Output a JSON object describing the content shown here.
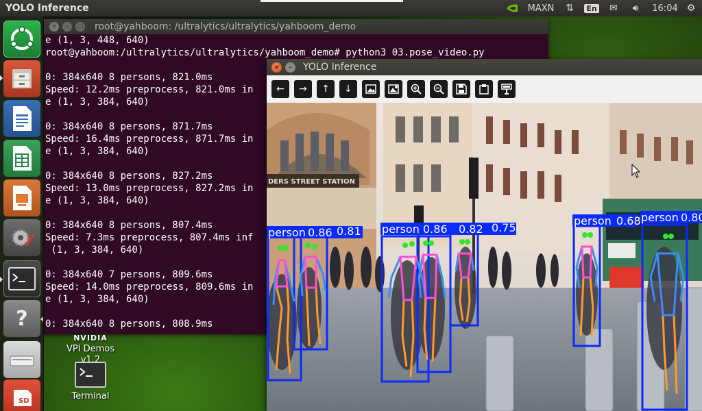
{
  "top_panel": {
    "app_title": "YOLO Inference",
    "power_mode": "MAXN",
    "keyboard_layout": "En",
    "clock": "16:04",
    "icons": [
      "nvidia-icon",
      "network-icon",
      "mail-icon",
      "sound-icon",
      "gear-icon"
    ]
  },
  "launcher": {
    "items": [
      "ubuntu-dash-icon",
      "files-icon",
      "writer-icon",
      "calc-icon",
      "impress-icon",
      "settings-icon",
      "terminal-icon",
      "help-icon",
      "drive-icon",
      "sd-card-icon"
    ]
  },
  "terminal": {
    "title": "root@yahboom: /ultralytics/ultralytics/yahboom_demo",
    "lines": [
      "e (1, 3, 448, 640)",
      "root@yahboom:/ultralytics/ultralytics/yahboom_demo# python3 03.pose_video.py",
      "",
      "0: 384x640 8 persons, 821.0ms",
      "Speed: 12.2ms preprocess, 821.0ms in",
      "e (1, 3, 384, 640)",
      "",
      "0: 384x640 8 persons, 871.7ms",
      "Speed: 16.4ms preprocess, 871.7ms in",
      "e (1, 3, 384, 640)",
      "",
      "0: 384x640 8 persons, 827.2ms",
      "Speed: 13.0ms preprocess, 827.2ms in",
      "e (1, 3, 384, 640)",
      "",
      "0: 384x640 8 persons, 807.4ms",
      "Speed: 7.3ms preprocess, 807.4ms inf",
      " (1, 3, 384, 640)",
      "",
      "0: 384x640 7 persons, 809.6ms",
      "Speed: 14.0ms preprocess, 809.6ms in",
      "e (1, 3, 384, 640)",
      "",
      "0: 384x640 8 persons, 808.9ms"
    ]
  },
  "desktop": {
    "vpi_brand": "NVIDIA",
    "vpi_name": "VPI Demos",
    "vpi_version": "v1.2",
    "terminal_label": "Terminal"
  },
  "yolo_window": {
    "title": "YOLO Inference",
    "toolbar": [
      "back-arrow-icon",
      "forward-arrow-icon",
      "up-arrow-icon",
      "down-arrow-icon",
      "image-icon",
      "image-settings-icon",
      "zoom-in-icon",
      "zoom-out-icon",
      "save-icon",
      "clipboard-icon",
      "properties-icon"
    ],
    "station_sign": "DERS STREET STATION",
    "detections": [
      {
        "label": "person",
        "score": "0.86"
      },
      {
        "label": "",
        "score": "0.81"
      },
      {
        "label": "person",
        "score": "0.86"
      },
      {
        "label": "",
        "score": "0.82"
      },
      {
        "label": "",
        "score": "0.75"
      },
      {
        "label": "person",
        "score": "0.68"
      },
      {
        "label": "person",
        "score": "0.80"
      }
    ]
  },
  "colors": {
    "terminal_bg": "#300a24",
    "box_blue": "#0a2aff",
    "keypoint_green": "#32e62a",
    "limb_orange": "#ff9a2a",
    "limb_pink": "#ff4fd8",
    "limb_blue": "#3a8cff"
  }
}
